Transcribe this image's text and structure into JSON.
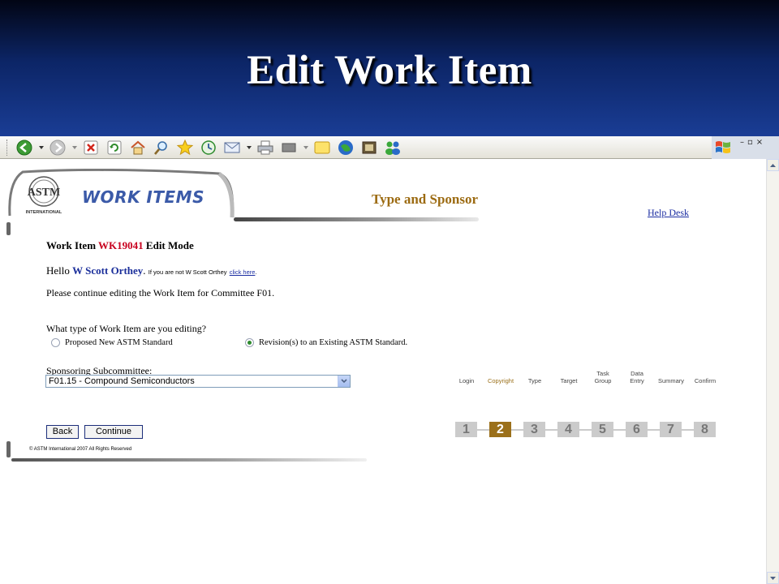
{
  "slide": {
    "title": "Edit Work Item"
  },
  "toolbar": {
    "icons": [
      "back-icon",
      "forward-icon",
      "stop-icon",
      "refresh-icon",
      "home-icon",
      "search-icon",
      "favorites-icon",
      "history-icon",
      "mail-icon",
      "print-icon",
      "edit-icon",
      "discuss-icon",
      "research-icon",
      "media-icon",
      "messenger-icon"
    ],
    "window_controls": [
      "–",
      "▫",
      "×"
    ]
  },
  "header": {
    "logo_text": "ASTM",
    "logo_subtext": "INTERNATIONAL",
    "app_name": "WORK ITEMS",
    "page_heading": "Type and Sponsor",
    "help_link": "Help Desk"
  },
  "work_item": {
    "prefix": "Work Item",
    "id": "WK19041",
    "mode": "Edit Mode"
  },
  "greeting": {
    "hello": "Hello",
    "user": "W Scott Orthey",
    "period": ".",
    "note": "If you are not W Scott Orthey",
    "link": "click here",
    "note_end": "."
  },
  "instructions": "Please continue editing the Work Item for Committee F01.",
  "question": {
    "text": "What type of Work Item are you editing?",
    "options": [
      {
        "label": "Proposed New ASTM Standard",
        "selected": false
      },
      {
        "label": "Revision(s) to an Existing ASTM Standard.",
        "selected": true
      }
    ]
  },
  "sponsor": {
    "label": "Sponsoring Subcommittee:",
    "selected": "F01.15 - Compound Semiconductors"
  },
  "buttons": {
    "back": "Back",
    "continue": "Continue"
  },
  "footer": {
    "copyright": "© ASTM International 2007 All Rights Reserved"
  },
  "steps": [
    {
      "label": "Login",
      "number": "1",
      "active": false
    },
    {
      "label": "Copyright",
      "number": "2",
      "active": true
    },
    {
      "label": "Type",
      "number": "3",
      "active": false
    },
    {
      "label": "Target",
      "number": "4",
      "active": false
    },
    {
      "label": "Task Group",
      "number": "5",
      "active": false
    },
    {
      "label": "Data Entry",
      "number": "6",
      "active": false
    },
    {
      "label": "Summary",
      "number": "7",
      "active": false
    },
    {
      "label": "Confirm",
      "number": "8",
      "active": false
    }
  ],
  "colors": {
    "banner": "#0c2566",
    "heading": "#9c6b12",
    "active_step": "#9b701a",
    "work_item_id": "#c8001e",
    "link": "#1c2ea2"
  }
}
